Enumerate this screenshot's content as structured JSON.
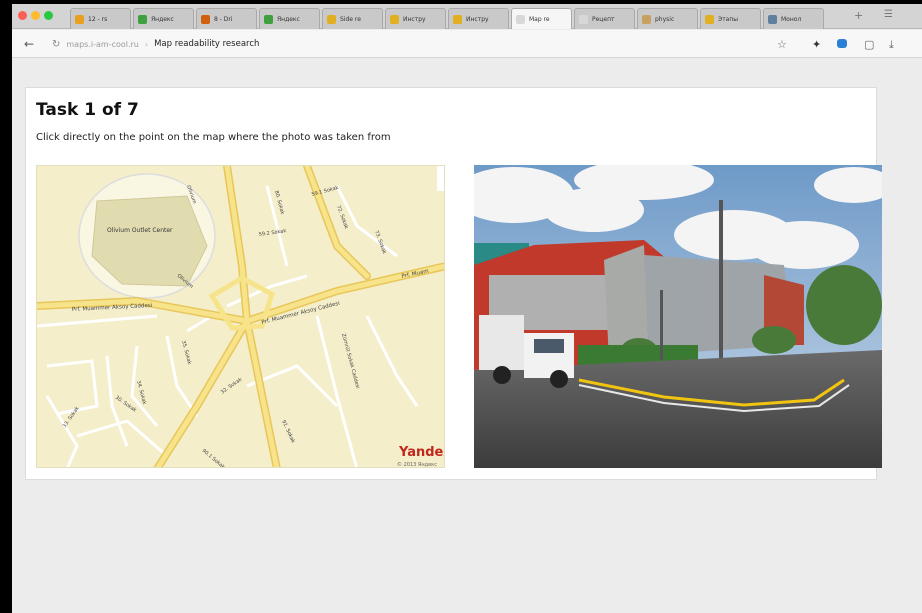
{
  "browser": {
    "tabs": [
      {
        "label": "12 - rs",
        "color": "#e8a020"
      },
      {
        "label": "Яндекс",
        "color": "#3fa03f"
      },
      {
        "label": "8 - Dri",
        "color": "#d06010"
      },
      {
        "label": "Яндекс",
        "color": "#3fa03f"
      },
      {
        "label": "Side re",
        "color": "#e0b020"
      },
      {
        "label": "Инстру",
        "color": "#e0b020"
      },
      {
        "label": "Инстру",
        "color": "#e0b020"
      },
      {
        "label": "Map re",
        "color": "#d8d8d8"
      },
      {
        "label": "Рецепт",
        "color": "#d8d8d8"
      },
      {
        "label": "physic",
        "color": "#c8a060"
      },
      {
        "label": "Этапы",
        "color": "#e0b020"
      },
      {
        "label": "Монол",
        "color": "#6080a0"
      }
    ],
    "active_tab_index": 7,
    "url_host": "maps.i-am-cool.ru",
    "page_title": "Map readability research"
  },
  "task": {
    "title": "Task 1 of 7",
    "instruction": "Click directly on the point on the map where the photo was taken from"
  },
  "map": {
    "watermark": "Yandex",
    "copyright": "© 2013 Яндекс",
    "place_label": "Olivium Outlet Center",
    "road_labels": [
      "Olivium",
      "Olivium",
      "Prf. Muammer Aksoy Caddesi",
      "Prf. Muammer Aksoy Caddesi",
      "Prf. Muam",
      "59.1 Sokak",
      "59.2 Sokak",
      "72. Sokak",
      "73. Sokak",
      "80. Sokak",
      "Zümrüt Sokak Caddesi",
      "34. Sokak",
      "35. Sokak",
      "30. Sokak",
      "33. Sokak",
      "32. Sokak",
      "91. Sokak",
      "90.1 Sokak"
    ]
  },
  "photo": {
    "alt": "Street view of shopping center with truck"
  }
}
